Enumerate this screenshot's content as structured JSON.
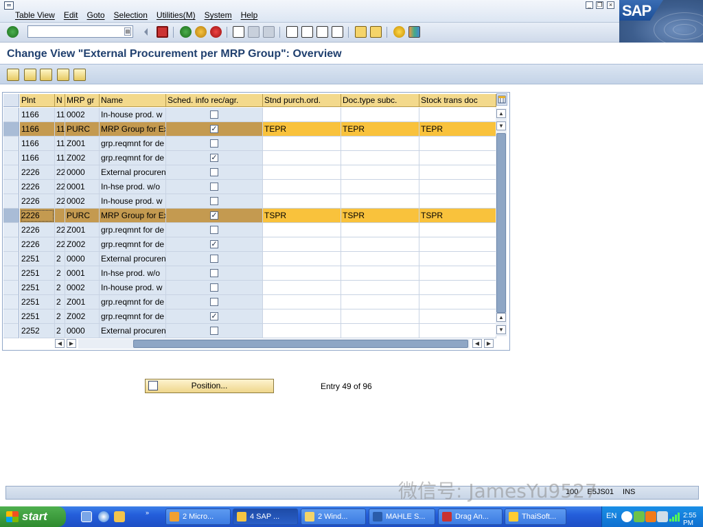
{
  "menu": [
    "Table View",
    "Edit",
    "Goto",
    "Selection",
    "Utilities(M)",
    "System",
    "Help"
  ],
  "logo": "SAP",
  "title": "Change View \"External Procurement per MRP Group\": Overview",
  "columns": [
    "Plnt",
    "N",
    "MRP gr",
    "Name",
    "Sched. info rec/agr.",
    "Stnd purch.ord.",
    "Doc.type subc.",
    "Stock trans doc"
  ],
  "rows": [
    {
      "plnt": "1166",
      "n": "11",
      "mrp": "0002",
      "name": "In-house prod. w",
      "sched": false,
      "std": "",
      "doc": "",
      "stock": "",
      "hl": false
    },
    {
      "plnt": "1166",
      "n": "11",
      "mrp": "PURC",
      "name": "MRP Group for Ex",
      "sched": true,
      "std": "TEPR",
      "doc": "TEPR",
      "stock": "TEPR",
      "hl": true
    },
    {
      "plnt": "1166",
      "n": "11",
      "mrp": "Z001",
      "name": "grp.reqmnt for de",
      "sched": false,
      "std": "",
      "doc": "",
      "stock": "",
      "hl": false
    },
    {
      "plnt": "1166",
      "n": "11",
      "mrp": "Z002",
      "name": "grp.reqmnt for de",
      "sched": true,
      "std": "",
      "doc": "",
      "stock": "",
      "hl": false
    },
    {
      "plnt": "2226",
      "n": "22",
      "mrp": "0000",
      "name": "External procuren",
      "sched": false,
      "std": "",
      "doc": "",
      "stock": "",
      "hl": false
    },
    {
      "plnt": "2226",
      "n": "22",
      "mrp": "0001",
      "name": "In-hse prod. w/o",
      "sched": false,
      "std": "",
      "doc": "",
      "stock": "",
      "hl": false
    },
    {
      "plnt": "2226",
      "n": "22",
      "mrp": "0002",
      "name": "In-house prod. w",
      "sched": false,
      "std": "",
      "doc": "",
      "stock": "",
      "hl": false
    },
    {
      "plnt": "2226",
      "n": "",
      "mrp": "PURC",
      "name": "MRP Group for Ex",
      "sched": true,
      "std": "TSPR",
      "doc": "TSPR",
      "stock": "TSPR",
      "hl": true
    },
    {
      "plnt": "2226",
      "n": "22",
      "mrp": "Z001",
      "name": "grp.reqmnt for de",
      "sched": false,
      "std": "",
      "doc": "",
      "stock": "",
      "hl": false
    },
    {
      "plnt": "2226",
      "n": "22",
      "mrp": "Z002",
      "name": "grp.reqmnt for de",
      "sched": true,
      "std": "",
      "doc": "",
      "stock": "",
      "hl": false
    },
    {
      "plnt": "2251",
      "n": "2",
      "mrp": "0000",
      "name": "External procuren",
      "sched": false,
      "std": "",
      "doc": "",
      "stock": "",
      "hl": false
    },
    {
      "plnt": "2251",
      "n": "2",
      "mrp": "0001",
      "name": "In-hse prod. w/o",
      "sched": false,
      "std": "",
      "doc": "",
      "stock": "",
      "hl": false
    },
    {
      "plnt": "2251",
      "n": "2",
      "mrp": "0002",
      "name": "In-house prod. w",
      "sched": false,
      "std": "",
      "doc": "",
      "stock": "",
      "hl": false
    },
    {
      "plnt": "2251",
      "n": "2",
      "mrp": "Z001",
      "name": "grp.reqmnt for de",
      "sched": false,
      "std": "",
      "doc": "",
      "stock": "",
      "hl": false
    },
    {
      "plnt": "2251",
      "n": "2",
      "mrp": "Z002",
      "name": "grp.reqmnt for de",
      "sched": true,
      "std": "",
      "doc": "",
      "stock": "",
      "hl": false
    },
    {
      "plnt": "2252",
      "n": "2",
      "mrp": "0000",
      "name": "External procuren",
      "sched": false,
      "std": "",
      "doc": "",
      "stock": "",
      "hl": false
    }
  ],
  "position_label": "Position...",
  "entry_info": "Entry 49 of 96",
  "status": {
    "client": "100",
    "server": "E5JS01",
    "mode": "INS"
  },
  "watermark": "微信号: JamesYu9527",
  "taskbar": {
    "start": "start",
    "tasks": [
      "2 Micro...",
      "4 SAP ...",
      "2 Wind...",
      "MAHLE S...",
      "Drag An...",
      "ThaiSoft..."
    ],
    "lang": "EN",
    "time": "2:55 PM"
  }
}
